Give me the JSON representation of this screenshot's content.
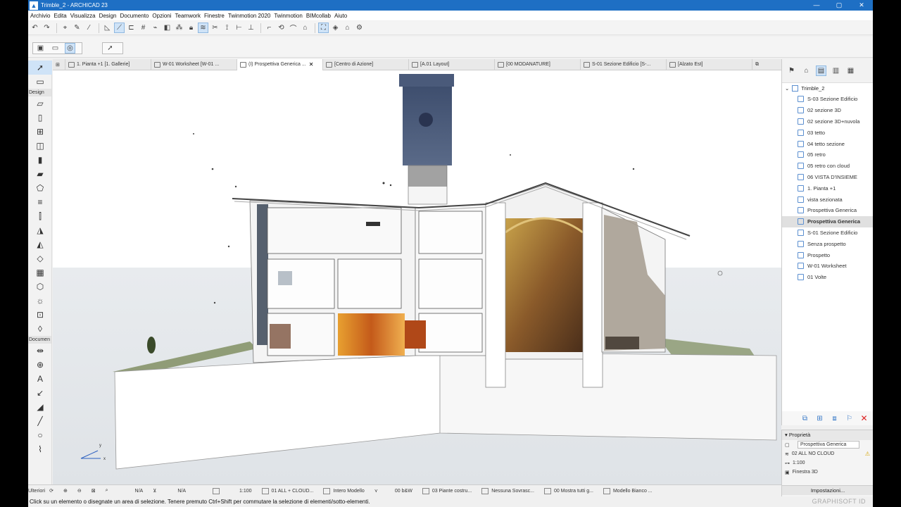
{
  "window": {
    "title": "Trimble_2 - ARCHICAD 23",
    "minimize": "—",
    "maximize": "▢",
    "close": "✕"
  },
  "menu": [
    "Archivio",
    "Edita",
    "Visualizza",
    "Design",
    "Documento",
    "Opzioni",
    "Teamwork",
    "Finestre",
    "Twinmotion 2020",
    "Twinmotion",
    "BIMcollab",
    "Aiuto"
  ],
  "toolbox": {
    "design_label": "Design",
    "document_label": "Documen",
    "more_label": "Ulteriori"
  },
  "tabs": [
    {
      "label": "1. Pianta +1 [1. Gallerie]",
      "active": false
    },
    {
      "label": "W-01 Worksheet [W-01 ...",
      "active": false
    },
    {
      "label": "(I) Prospettiva Generica ...",
      "active": true
    },
    {
      "label": "[Centro di Azione]",
      "active": false
    },
    {
      "label": "[A.01 Layout]",
      "active": false
    },
    {
      "label": "[00 MODANATURE]",
      "active": false
    },
    {
      "label": "S-01 Sezione Edificio [S-...",
      "active": false
    },
    {
      "label": "[Alzato Est]",
      "active": false
    }
  ],
  "navigator": {
    "root": "Trimble_2",
    "items": [
      {
        "label": "S-03 Sezione Edificio",
        "selected": false
      },
      {
        "label": "02 sezione 3D",
        "selected": false
      },
      {
        "label": "02 sezione 3D+nuvola",
        "selected": false
      },
      {
        "label": "03 tetto",
        "selected": false
      },
      {
        "label": "04 tetto sezione",
        "selected": false
      },
      {
        "label": "05 retro",
        "selected": false
      },
      {
        "label": "05 retro con cloud",
        "selected": false
      },
      {
        "label": "06 VISTA D'INSIEME",
        "selected": false
      },
      {
        "label": "1. Pianta +1",
        "selected": false
      },
      {
        "label": "vista sezionata",
        "selected": false
      },
      {
        "label": "Prospettiva Generica",
        "selected": false
      },
      {
        "label": "Prospettiva Generica",
        "selected": true
      },
      {
        "label": "S-01 Sezione Edificio",
        "selected": false
      },
      {
        "label": "Senza prospetto",
        "selected": false
      },
      {
        "label": "Prospetto",
        "selected": false
      },
      {
        "label": "W-01 Worksheet",
        "selected": false
      },
      {
        "label": "01 Volte",
        "selected": false
      }
    ]
  },
  "properties": {
    "header": "Proprietà",
    "name_value": "Prospettiva Generica",
    "layer_combo": "02 ALL NO CLOUD",
    "scale": "1:100",
    "window_type": "Finestra 3D",
    "settings_label": "Impostazioni..."
  },
  "bottombar": {
    "na1": "N/A",
    "na2": "N/A",
    "scale": "1:100",
    "layer": "01 ALL + CLOUD...",
    "model": "Intero Modello",
    "pen": "00 b&W",
    "mvo": "03 Piante costru...",
    "override": "Nessuna Sovrasc...",
    "renovation": "00 Mostra tutti g...",
    "model_style": "Modello Bianco ..."
  },
  "status": {
    "message": "Click su un elemento o disegnate un area di selezione. Tenere premuto Ctrl+Shift per commutare la selezione di elementi/sotto-elementi.",
    "brand": "GRAPHISOFT ID"
  },
  "axes": {
    "x": "x",
    "y": "y"
  },
  "colors": {
    "titlebar": "#1e6fc4",
    "accent_highlight": "#cfe3f7",
    "warning": "#d6a400",
    "close_red": "#dd2222"
  }
}
